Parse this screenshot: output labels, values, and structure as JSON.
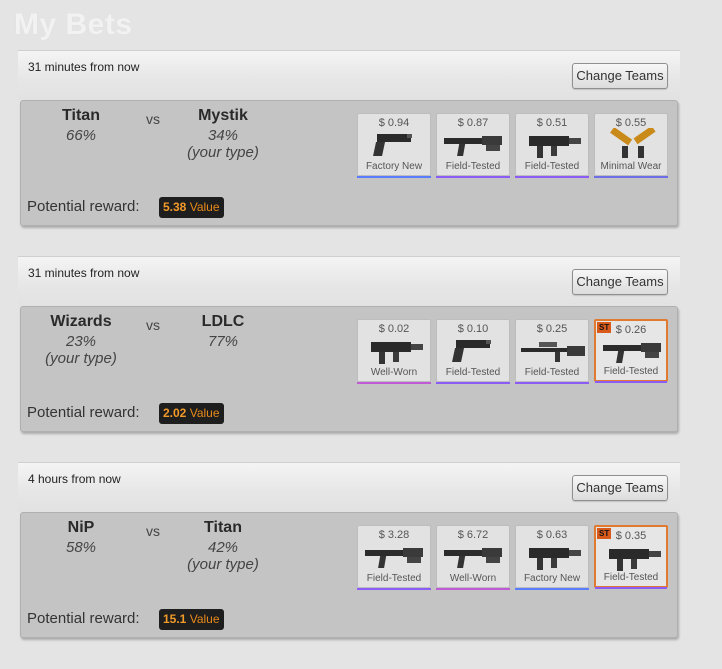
{
  "page": {
    "title": "My Bets"
  },
  "colors": {
    "factory_new": "#5a7cff",
    "minimal_wear": "#6e6ee6",
    "field_tested": "#8b5cf6",
    "well_worn": "#c05bd6",
    "stattrak": "#e07a30",
    "reward_value": "#f29a2a"
  },
  "bets": [
    {
      "time": "31 minutes from now",
      "change_label": "Change Teams",
      "team1": {
        "name": "Titan",
        "pct": "66%",
        "note": ""
      },
      "vs": "vs",
      "team2": {
        "name": "Mystik",
        "pct": "34%",
        "note": "(your type)"
      },
      "reward_label": "Potential reward:",
      "reward_amount": "5.38",
      "reward_unit": "Value",
      "items": [
        {
          "price": "$ 0.94",
          "condition": "Factory New",
          "icon": "pistol-icon",
          "stattrak": false
        },
        {
          "price": "$ 0.87",
          "condition": "Field-Tested",
          "icon": "rifle-icon",
          "stattrak": false
        },
        {
          "price": "$ 0.51",
          "condition": "Field-Tested",
          "icon": "smg-icon",
          "stattrak": false
        },
        {
          "price": "$ 0.55",
          "condition": "Minimal Wear",
          "icon": "dual-pistols-icon",
          "stattrak": false
        }
      ]
    },
    {
      "time": "31 minutes from now",
      "change_label": "Change Teams",
      "team1": {
        "name": "Wizards",
        "pct": "23%",
        "note": "(your type)"
      },
      "vs": "vs",
      "team2": {
        "name": "LDLC",
        "pct": "77%",
        "note": ""
      },
      "reward_label": "Potential reward:",
      "reward_amount": "2.02",
      "reward_unit": "Value",
      "items": [
        {
          "price": "$ 0.02",
          "condition": "Well-Worn",
          "icon": "smg-icon",
          "stattrak": false
        },
        {
          "price": "$ 0.10",
          "condition": "Field-Tested",
          "icon": "pistol-icon",
          "stattrak": false
        },
        {
          "price": "$ 0.25",
          "condition": "Field-Tested",
          "icon": "sniper-icon",
          "stattrak": false
        },
        {
          "price": "$ 0.26",
          "condition": "Field-Tested",
          "icon": "rifle-icon",
          "stattrak": true,
          "st_label": "ST"
        }
      ]
    },
    {
      "time": "4 hours from now",
      "change_label": "Change Teams",
      "team1": {
        "name": "NiP",
        "pct": "58%",
        "note": ""
      },
      "vs": "vs",
      "team2": {
        "name": "Titan",
        "pct": "42%",
        "note": "(your type)"
      },
      "reward_label": "Potential reward:",
      "reward_amount": "15.1",
      "reward_unit": "Value",
      "items": [
        {
          "price": "$ 3.28",
          "condition": "Field-Tested",
          "icon": "rifle-icon",
          "stattrak": false
        },
        {
          "price": "$ 6.72",
          "condition": "Well-Worn",
          "icon": "rifle-icon",
          "stattrak": false
        },
        {
          "price": "$ 0.63",
          "condition": "Factory New",
          "icon": "smg-icon",
          "stattrak": false
        },
        {
          "price": "$ 0.35",
          "condition": "Field-Tested",
          "icon": "smg-icon",
          "stattrak": true,
          "st_label": "ST"
        }
      ]
    }
  ]
}
